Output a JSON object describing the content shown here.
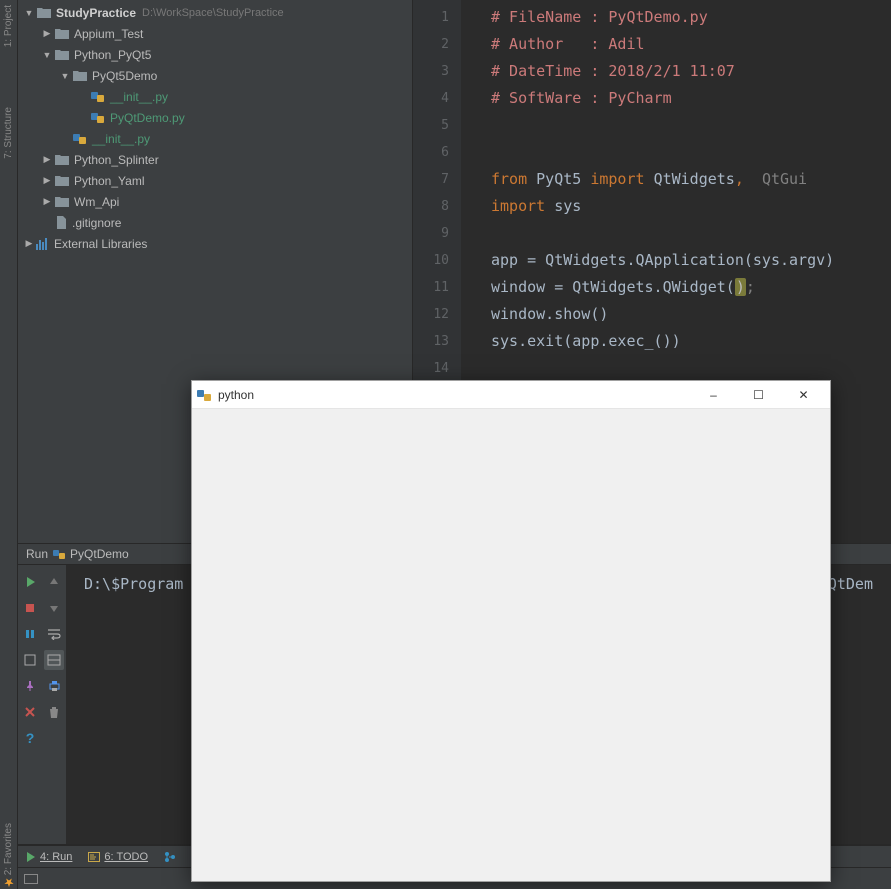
{
  "left_gutter": {
    "project_label": "1: Project",
    "structure_label": "7: Structure",
    "favorites_label": "2: Favorites"
  },
  "tree": {
    "root_name": "StudyPractice",
    "root_path": "D:\\WorkSpace\\StudyPractice",
    "items": [
      {
        "indent": 1,
        "arrow": "▶",
        "icon": "folder",
        "label": "Appium_Test"
      },
      {
        "indent": 1,
        "arrow": "▼",
        "icon": "folder",
        "label": "Python_PyQt5"
      },
      {
        "indent": 2,
        "arrow": "▼",
        "icon": "folder",
        "label": "PyQt5Demo"
      },
      {
        "indent": 3,
        "arrow": "",
        "icon": "py",
        "label": "__init__.py",
        "hl": true
      },
      {
        "indent": 3,
        "arrow": "",
        "icon": "py",
        "label": "PyQtDemo.py",
        "hl": true
      },
      {
        "indent": 2,
        "arrow": "",
        "icon": "py",
        "label": "__init__.py",
        "hl": true
      },
      {
        "indent": 1,
        "arrow": "▶",
        "icon": "folder",
        "label": "Python_Splinter"
      },
      {
        "indent": 1,
        "arrow": "▶",
        "icon": "folder",
        "label": "Python_Yaml"
      },
      {
        "indent": 1,
        "arrow": "▶",
        "icon": "folder",
        "label": "Wm_Api"
      },
      {
        "indent": 1,
        "arrow": "",
        "icon": "file",
        "label": ".gitignore"
      }
    ],
    "ext_lib": "External Libraries"
  },
  "editor": {
    "lines": [
      {
        "n": 1,
        "segs": [
          {
            "t": "# FileName : PyQtDemo.py",
            "c": "c-comment"
          }
        ]
      },
      {
        "n": 2,
        "segs": [
          {
            "t": "# Author   : Adil",
            "c": "c-comment"
          }
        ]
      },
      {
        "n": 3,
        "segs": [
          {
            "t": "# DateTime : 2018/2/1 11:07",
            "c": "c-comment"
          }
        ]
      },
      {
        "n": 4,
        "segs": [
          {
            "t": "# SoftWare : PyCharm",
            "c": "c-comment"
          }
        ]
      },
      {
        "n": 5,
        "segs": []
      },
      {
        "n": 6,
        "segs": []
      },
      {
        "n": 7,
        "segs": [
          {
            "t": "from ",
            "c": "c-keyword"
          },
          {
            "t": "PyQt5 ",
            "c": "c-normal"
          },
          {
            "t": "import ",
            "c": "c-keyword"
          },
          {
            "t": "QtWidgets",
            "c": "c-normal"
          },
          {
            "t": ",  ",
            "c": "c-keyword"
          },
          {
            "t": "QtGui",
            "c": "c-dim"
          }
        ]
      },
      {
        "n": 8,
        "segs": [
          {
            "t": "import ",
            "c": "c-keyword"
          },
          {
            "t": "sys",
            "c": "c-normal"
          }
        ]
      },
      {
        "n": 9,
        "segs": []
      },
      {
        "n": 10,
        "segs": [
          {
            "t": "app = QtWidgets.QApplication(sys.argv)",
            "c": "c-normal"
          }
        ]
      },
      {
        "n": 11,
        "segs": [
          {
            "t": "window = QtWidgets.QWidget(",
            "c": "c-normal"
          },
          {
            "t": ")",
            "c": "c-highlight"
          },
          {
            "t": ";",
            "c": "c-dim"
          }
        ]
      },
      {
        "n": 12,
        "segs": [
          {
            "t": "window.show()",
            "c": "c-normal"
          }
        ]
      },
      {
        "n": 13,
        "segs": [
          {
            "t": "sys.exit(app.exec_())",
            "c": "c-normal"
          }
        ]
      },
      {
        "n": 14,
        "segs": []
      }
    ]
  },
  "run": {
    "label": "Run",
    "config": "PyQtDemo"
  },
  "console": {
    "output_left": "D:\\$Program",
    "output_right": "PyQtDem"
  },
  "bottom": {
    "run": "4: Run",
    "todo": "6: TODO"
  },
  "popup": {
    "title": "python",
    "min": "–",
    "max": "☐",
    "close": "✕"
  }
}
